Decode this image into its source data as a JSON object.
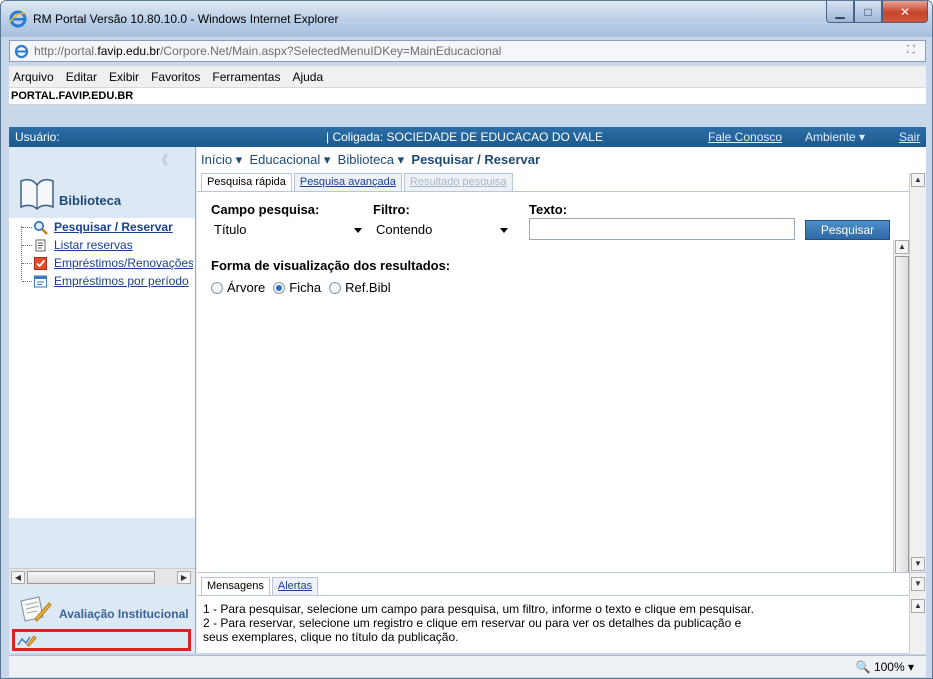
{
  "window": {
    "title": "RM Portal Versão 10.80.10.0 - Windows Internet Explorer",
    "url_prefix": "http://portal.",
    "url_domain": "favip.edu.br",
    "url_rest": "/Corpore.Net/Main.aspx?SelectedMenuIDKey=MainEducacional"
  },
  "menubar": {
    "items": [
      "Arquivo",
      "Editar",
      "Exibir",
      "Favoritos",
      "Ferramentas",
      "Ajuda"
    ]
  },
  "site_title": "PORTAL.FAVIP.EDU.BR",
  "topbar": {
    "usuario": "Usuário:",
    "coligada": "| Coligada: SOCIEDADE DE EDUCACAO DO VALE",
    "fale_conosco": "Fale Conosco",
    "ambiente": "Ambiente ▾",
    "sair": "Sair"
  },
  "leftpanel": {
    "collapse": "《",
    "section_title": "Biblioteca",
    "items": [
      {
        "label": "Pesquisar / Reservar"
      },
      {
        "label": "Listar reservas"
      },
      {
        "label": "Empréstimos/Renovações"
      },
      {
        "label": "Empréstimos por período"
      }
    ],
    "bottom_title": "Avaliação Institucional"
  },
  "breadcrumb": {
    "inicio": "Início ▾",
    "educacional": "Educacional ▾",
    "biblioteca": "Biblioteca ▾",
    "current": "Pesquisar / Reservar"
  },
  "tabs": [
    {
      "label": "Pesquisa rápida"
    },
    {
      "label": "Pesquisa avançada"
    },
    {
      "label": "Resultado pesquisa"
    }
  ],
  "form": {
    "campo_label": "Campo pesquisa:",
    "campo_value": "Título",
    "filtro_label": "Filtro:",
    "filtro_value": "Contendo",
    "texto_label": "Texto:",
    "texto_value": "",
    "search_button": "Pesquisar",
    "view_label": "Forma de visualização dos resultados:",
    "view_options": [
      "Árvore",
      "Ficha",
      "Ref.Bibl"
    ],
    "view_selected": "Ficha"
  },
  "messages": {
    "tabs": [
      "Mensagens",
      "Alertas"
    ],
    "line1": "1 - Para pesquisar, selecione um campo para pesquisa, um filtro, informe o texto e clique em pesquisar.",
    "line2": "2 - Para reservar, selecione um registro e clique em reservar ou para ver os detalhes da publicação e",
    "line3": "seus exemplares, clique no título da publicação."
  },
  "statusbar": {
    "zoom": "100%"
  },
  "colors": {
    "topbar": "#1e5a8d",
    "link": "#1a3f8f",
    "highlight_box": "#e02020",
    "search_button": "#2e6aa6"
  }
}
